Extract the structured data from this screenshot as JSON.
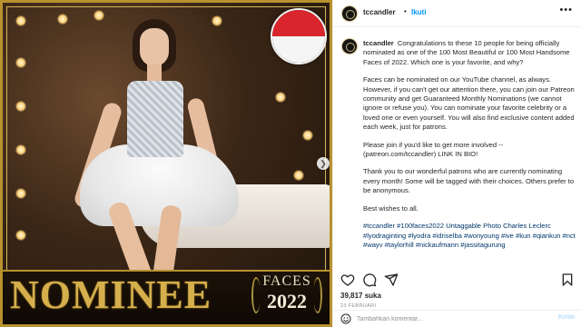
{
  "post": {
    "image": {
      "nominee_text": "NOMINEE",
      "faces_title": "FACES",
      "faces_year": "2022",
      "flag_colors": [
        "#d8262c",
        "#f5f5f5"
      ],
      "frame_color": "#b8922f",
      "next_icon": "chevron-right-icon"
    }
  },
  "header": {
    "username": "tccandler",
    "separator": "•",
    "follow_label": "Ikuti",
    "more_icon": "more-options-icon"
  },
  "caption": {
    "username": "tccandler",
    "paragraph_1": "Congratulations to these 10 people for being officially nominated as one of the 100 Most Beautiful or 100 Most Handsome Faces of 2022.  Which one is your favorite, and why?",
    "paragraph_2": "Faces can be nominated on our YouTube channel, as always. However, if you can't get our attention there, you can join our Patreon community and get Guaranteed Monthly Nominations (we cannot ignore or refuse you).  You can nominate your favorite celebrity or a loved one or even yourself.  You will also find exclusive content added each week, just for patrons.",
    "paragraph_3": "Please join if you'd like to get more involved -- (patreon.com/tccandler) LINK IN BIO!",
    "paragraph_4": "Thank you to our wonderful patrons who are currently nominating every month!  Some will be tagged with their choices.  Others prefer to be anonymous.",
    "paragraph_5": "Best wishes to all.",
    "hashtags": "#tccandler #100faces2022 Untaggable Photo Charles Leclerc #lyodraginting #lyodra #idriselba #wonyoung #ive #kun #qiankun #nct #wayv #taylorhill #nickaufmann #jassitagurung"
  },
  "actions": {
    "icons": [
      "heart-icon",
      "comment-icon",
      "share-icon",
      "bookmark-icon"
    ]
  },
  "likes": "39,817 suka",
  "date": "23 FEBRUARI",
  "comment": {
    "placeholder": "Tambahkan komentar...",
    "post_label": "Kirim"
  },
  "colors": {
    "link": "#0095f6",
    "hashtag": "#00376b",
    "gold": "#d4af4c"
  }
}
